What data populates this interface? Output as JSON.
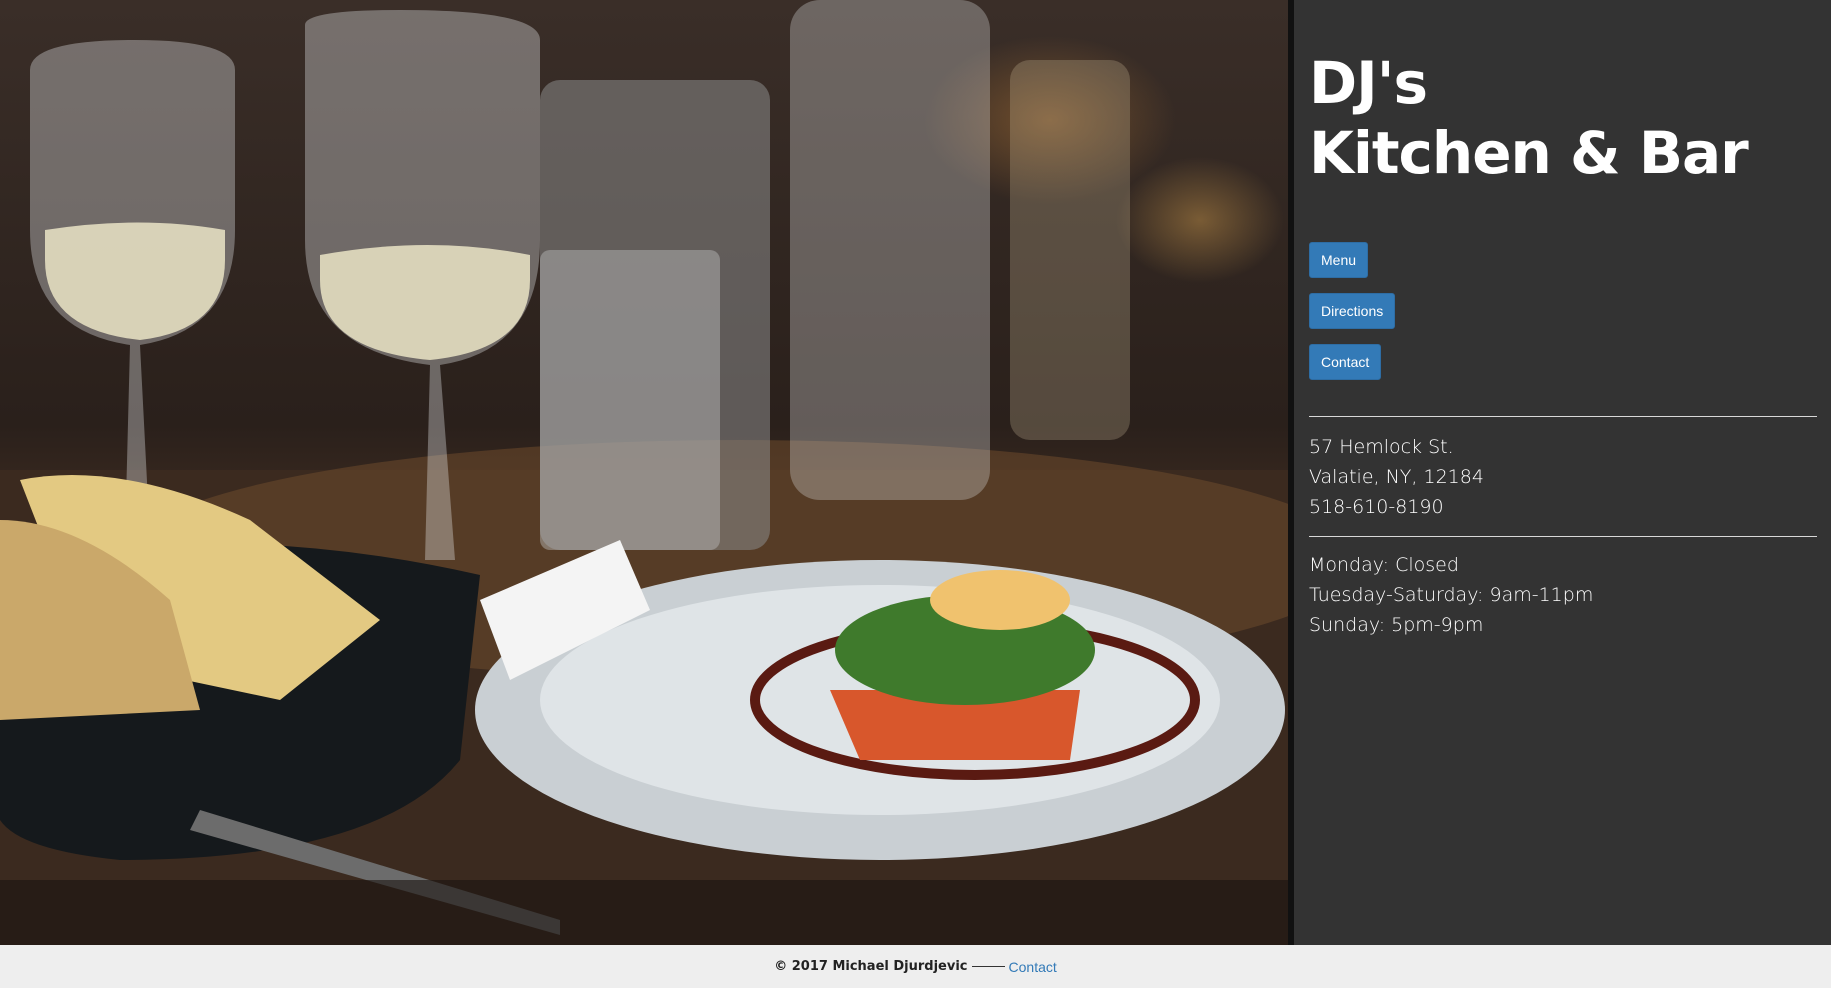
{
  "header": {
    "title_line1": "DJ's",
    "title_line2": "Kitchen & Bar"
  },
  "nav": {
    "buttons": [
      "Menu",
      "Directions",
      "Contact"
    ]
  },
  "address": {
    "street": "57 Hemlock St.",
    "city": "Valatie, NY, 12184",
    "phone": "518-610-8190"
  },
  "hours": [
    "Monday: Closed",
    "Tuesday-Saturday: 9am-11pm",
    "Sunday: 5pm-9pm"
  ],
  "footer": {
    "copyright": "© 2017 Michael Djurdjevic",
    "contact_link": "Contact"
  },
  "colors": {
    "panel_bg": "#333333",
    "button_bg": "#337ab7",
    "footer_bg": "#eeeeee",
    "link": "#337ab7"
  },
  "icons": {
    "hero": "restaurant-table-photo"
  }
}
